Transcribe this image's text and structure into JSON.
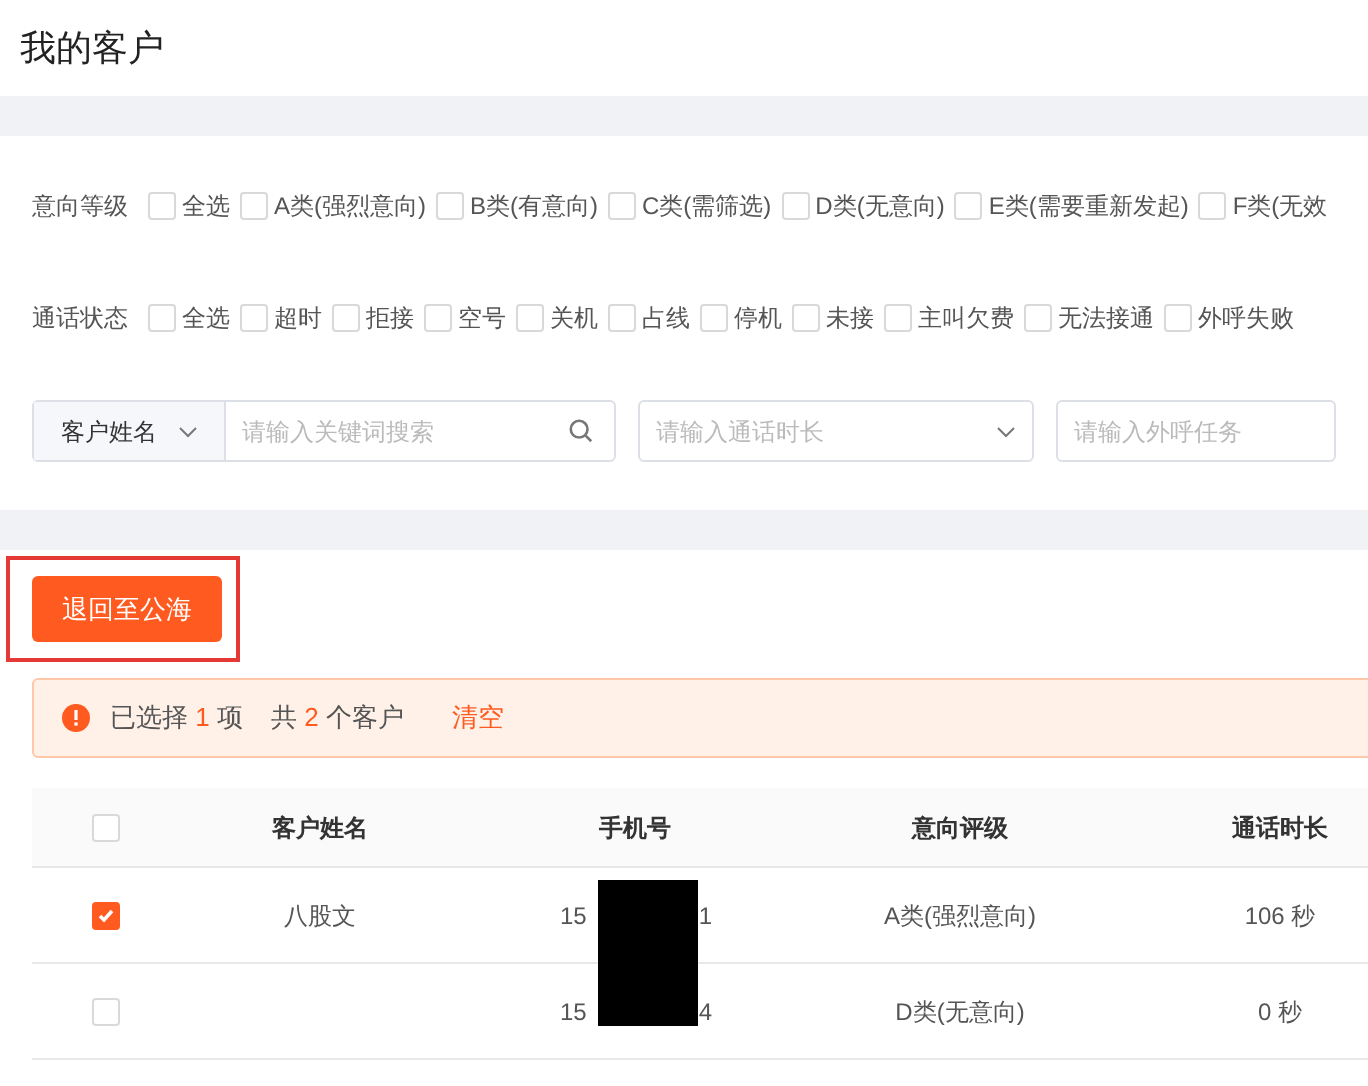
{
  "page_title": "我的客户",
  "filters": [
    {
      "label": "意向等级",
      "options": [
        {
          "label": "全选",
          "checked": false
        },
        {
          "label": "A类(强烈意向)",
          "checked": false
        },
        {
          "label": "B类(有意向)",
          "checked": false
        },
        {
          "label": "C类(需筛选)",
          "checked": false
        },
        {
          "label": "D类(无意向)",
          "checked": false
        },
        {
          "label": "E类(需要重新发起)",
          "checked": false
        },
        {
          "label": "F类(无效",
          "checked": false
        }
      ]
    },
    {
      "label": "通话状态",
      "options": [
        {
          "label": "全选",
          "checked": false
        },
        {
          "label": "超时",
          "checked": false
        },
        {
          "label": "拒接",
          "checked": false
        },
        {
          "label": "空号",
          "checked": false
        },
        {
          "label": "关机",
          "checked": false
        },
        {
          "label": "占线",
          "checked": false
        },
        {
          "label": "停机",
          "checked": false
        },
        {
          "label": "未接",
          "checked": false
        },
        {
          "label": "主叫欠费",
          "checked": false
        },
        {
          "label": "无法接通",
          "checked": false
        },
        {
          "label": "外呼失败",
          "checked": false
        }
      ]
    }
  ],
  "search": {
    "field_select": "客户姓名",
    "keyword_placeholder": "请输入关键词搜索",
    "duration_placeholder": "请输入通话时长",
    "task_placeholder": "请输入外呼任务"
  },
  "return_button": "退回至公海",
  "selection_alert": {
    "prefix": "已选择",
    "selected_count": "1",
    "unit": "项",
    "total_prefix": "共",
    "total_count": "2",
    "total_suffix": "个客户",
    "clear": "清空"
  },
  "table": {
    "columns": [
      "客户姓名",
      "手机号",
      "意向评级",
      "通话时长"
    ],
    "all_checked": false,
    "rows": [
      {
        "selected": true,
        "name": "八股文",
        "phone_start": "15",
        "phone_end": "1",
        "level": "A类(强烈意向)",
        "duration": "106 秒"
      },
      {
        "selected": false,
        "name": "",
        "phone_start": "15",
        "phone_end": "4",
        "level": "D类(无意向)",
        "duration": "0 秒"
      }
    ]
  }
}
